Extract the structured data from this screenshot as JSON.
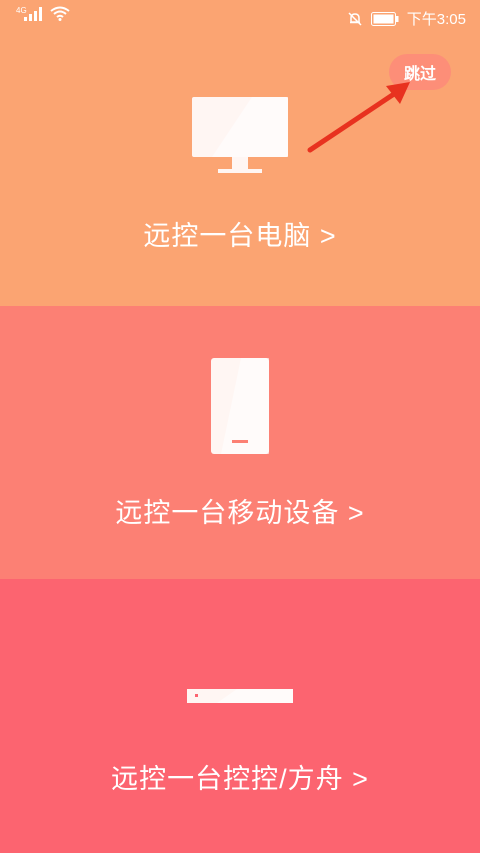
{
  "statusbar": {
    "network": "4G",
    "time": "下午3:05",
    "icons": [
      "signal-icon",
      "wifi-icon",
      "mute-bell-icon",
      "battery-icon"
    ]
  },
  "skip_button": {
    "label": "跳过"
  },
  "options": [
    {
      "label": "远控一台电脑 >",
      "icon": "monitor-icon",
      "bg": "#FBA472"
    },
    {
      "label": "远控一台移动设备 >",
      "icon": "phone-icon",
      "bg": "#FC8074"
    },
    {
      "label": "远控一台控控/方舟 >",
      "icon": "box-device-icon",
      "bg": "#FC6470"
    }
  ],
  "colors": {
    "annotation_arrow": "#E8321F"
  }
}
